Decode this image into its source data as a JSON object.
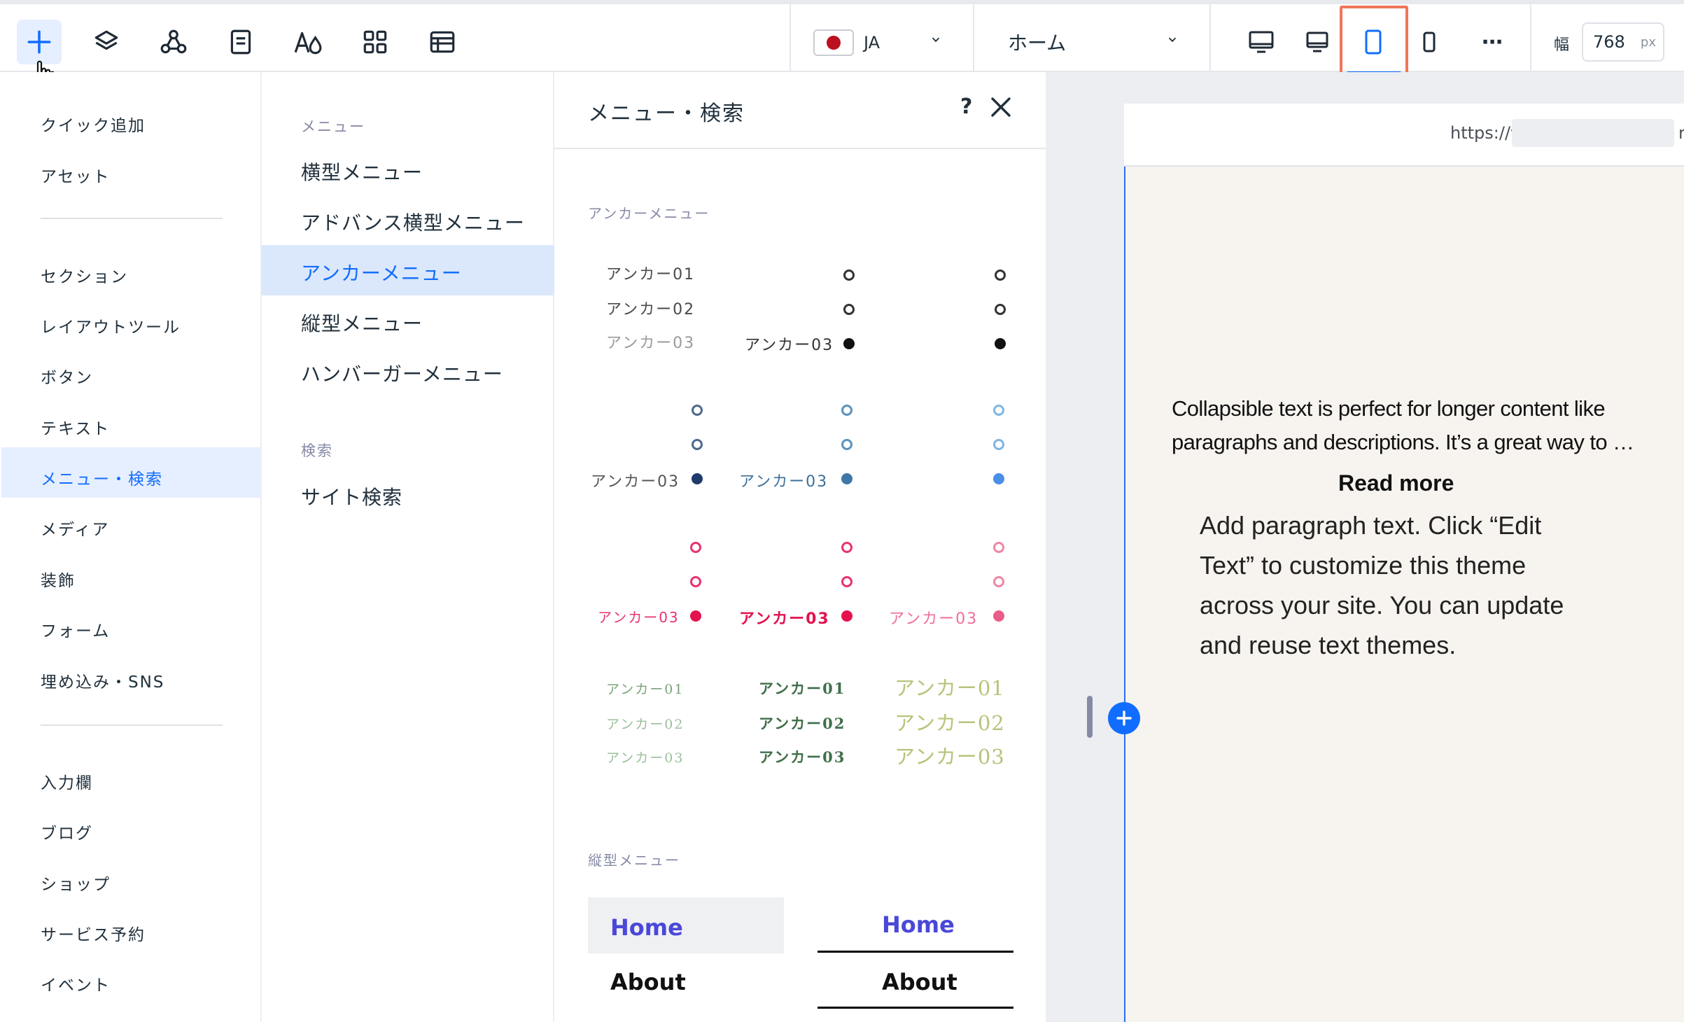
{
  "toolbar": {
    "tools": [
      "add-elements",
      "layers",
      "apps",
      "pages",
      "theme",
      "app-market",
      "cms"
    ],
    "language_code": "JA",
    "page_name": "ホーム",
    "devices": [
      "desktop-large",
      "desktop",
      "tablet",
      "mobile"
    ],
    "more_label": "⋯",
    "width_label": "幅",
    "width_value": "768",
    "width_unit": "px"
  },
  "leftnav": {
    "items": [
      "クイック追加",
      "アセット",
      "セクション",
      "レイアウトツール",
      "ボタン",
      "テキスト",
      "メニュー・検索",
      "メディア",
      "装飾",
      "フォーム",
      "埋め込み・SNS",
      "入力欄",
      "ブログ",
      "ショップ",
      "サービス予約",
      "イベント"
    ],
    "active": "メニュー・検索"
  },
  "submenu": {
    "menu_heading": "メニュー",
    "menu_items": [
      "横型メニュー",
      "アドバンス横型メニュー",
      "アンカーメニュー",
      "縦型メニュー",
      "ハンバーガーメニュー"
    ],
    "active": "アンカーメニュー",
    "search_heading": "検索",
    "search_items": [
      "サイト検索"
    ]
  },
  "panel": {
    "title": "メニュー・検索",
    "help": "?",
    "anchor_section": "アンカーメニュー",
    "anchor_01": "アンカー01",
    "anchor_02": "アンカー02",
    "anchor_03": "アンカー03",
    "vertical_section": "縦型メニュー",
    "vertical_items": [
      "Home",
      "About"
    ]
  },
  "canvas": {
    "url_prefix": "https://v",
    "url_suffix": "r",
    "collapsible_text": "Collapsible text is perfect for longer content like paragraphs and descriptions. It’s a great way to …",
    "read_more": "Read more",
    "paragraph_text": "Add paragraph text. Click “Edit Text” to customize this theme across your site. You can update and reuse text themes."
  },
  "colors": {
    "accent": "#116dff",
    "highlight": "#e6efff",
    "active_frame": "#f0765a",
    "page_bg": "#f7f3ef",
    "anchor_pink": "#e8336d",
    "anchor_navy": "#1f3a6b",
    "anchor_blue": "#4a8ee8",
    "anchor_green": "#5e8f5e"
  }
}
